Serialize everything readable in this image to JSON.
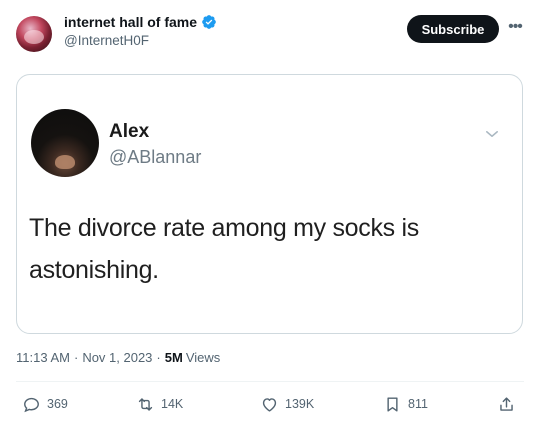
{
  "author": {
    "display_name": "internet hall of fame",
    "handle": "@InternetH0F"
  },
  "subscribe_label": "Subscribe",
  "quoted": {
    "name": "Alex",
    "handle": "@ABlannar",
    "text": "The divorce rate among my socks is astonishing."
  },
  "meta": {
    "time": "11:13 AM",
    "separator1": "·",
    "date": "Nov 1, 2023",
    "separator2": "·",
    "views_count": "5M",
    "views_label": "Views"
  },
  "actions": {
    "replies": "369",
    "reposts": "14K",
    "likes": "139K",
    "bookmarks": "811"
  },
  "icons": [
    "verified-badge-icon",
    "more-icon",
    "chevron-down-icon",
    "reply-icon",
    "retweet-icon",
    "heart-icon",
    "bookmark-icon",
    "share-icon"
  ],
  "colors": {
    "verified": "#1d9bf0",
    "subscribe_bg": "#0f1419",
    "secondary_text": "#536471"
  }
}
